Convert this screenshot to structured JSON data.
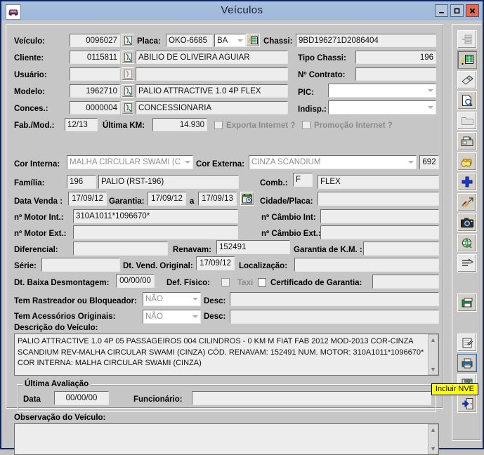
{
  "window": {
    "title": "Veículos",
    "icon": "car-icon",
    "buttons": {
      "minimize": "–",
      "maximize": "□",
      "close": "X"
    }
  },
  "form": {
    "veiculo": {
      "label": "Veículo:",
      "code": "0096027"
    },
    "placa": {
      "label": "Placa:",
      "value": "OKO-6685",
      "uf": "BA"
    },
    "chassi": {
      "label": "Chassi:",
      "value": "9BD196271D2086404"
    },
    "cliente": {
      "label": "Cliente:",
      "code": "0115811",
      "name": "ABILIO DE OLIVEIRA AGUIAR"
    },
    "tipo_chassi": {
      "label": "Tipo Chassi:",
      "value": "196"
    },
    "usuario": {
      "label": "Usuário:",
      "code": "",
      "name": ""
    },
    "n_contrato": {
      "label": "Nº Contrato:",
      "value": ""
    },
    "modelo": {
      "label": "Modelo:",
      "code": "1962710",
      "name": "PALIO ATTRACTIVE 1.0 4P FLEX"
    },
    "pic": {
      "label": "PIC:",
      "value": ""
    },
    "conces": {
      "label": "Conces.:",
      "code": "0000004",
      "name": "CONCESSIONARIA"
    },
    "indisp": {
      "label": "Indisp.:",
      "value": ""
    },
    "fab_mod": {
      "label": "Fab./Mod.:",
      "value": "12/13"
    },
    "ultima_km": {
      "label": "Última KM:",
      "value": "14.930"
    },
    "exporta_internet": {
      "label": "Exporta Internet ?",
      "checked": false
    },
    "promocao_internet": {
      "label": "Promoção Internet ?",
      "checked": false
    },
    "cor_interna": {
      "label": "Cor Interna:",
      "value": "MALHA CIRCULAR SWAMI (C"
    },
    "cor_externa": {
      "label": "Cor Externa:",
      "value": "CINZA SCANDIUM",
      "code": "692"
    },
    "familia": {
      "label": "Família:",
      "code": "196",
      "name": "PALIO (RST-196)"
    },
    "comb": {
      "label": "Comb.:",
      "code": "F",
      "name": "FLEX"
    },
    "data_venda": {
      "label": "Data Venda :",
      "value": "17/09/12"
    },
    "garantia": {
      "label": "Garantia:",
      "from": "17/09/12",
      "sep": "a",
      "to": "17/09/13"
    },
    "cidade_placa": {
      "label": "Cidade/Placa:",
      "value": ""
    },
    "n_motor_int": {
      "label": "nº Motor Int.:",
      "value": "310A1011*1096670*"
    },
    "n_cambio_int": {
      "label": "nº Câmbio Int:",
      "value": ""
    },
    "n_motor_ext": {
      "label": "nº Motor Ext.:",
      "value": ""
    },
    "n_cambio_ext": {
      "label": "nº Câmbio Ext.:",
      "value": ""
    },
    "diferencial": {
      "label": "Diferencial:",
      "value": ""
    },
    "renavam": {
      "label": "Renavam:",
      "value": "152491"
    },
    "garantia_km": {
      "label": "Garantia de K.M. :",
      "value": ""
    },
    "serie": {
      "label": "Série:",
      "value": ""
    },
    "dt_vend_original": {
      "label": "Dt. Vend. Original:",
      "value": "17/09/12"
    },
    "localizacao": {
      "label": "Localização:",
      "value": ""
    },
    "dt_baixa": {
      "label": "Dt. Baixa Desmontagem:",
      "value": "00/00/00"
    },
    "def_fisico": {
      "label": "Def. Físico:",
      "checked": false
    },
    "taxi": {
      "label": "Taxi",
      "checked": false
    },
    "certificado_garantia": {
      "label": "Certificado de Garantia:",
      "value": ""
    },
    "rastreador": {
      "label": "Tem Rastreador ou Bloqueador:",
      "value": "NÃO",
      "desc_label": "Desc:",
      "desc": ""
    },
    "acessorios": {
      "label": "Tem Acessórios Originais:",
      "value": "NÃO",
      "desc_label": "Desc:",
      "desc": ""
    },
    "descricao_veiculo": {
      "label": "Descrição do Veículo:",
      "text": "PALIO ATTRACTIVE 1.0 4P 05 PASSAGEIROS 004 CILINDROS - 0 KM M FIAT FAB 2012 MOD-2013 COR-CINZA SCANDIUM REV-MALHA CIRCULAR SWAMI (CINZA) CÓD. RENAVAM: 152491 NUM. MOTOR: 310A1011*1096670* COR INTERNA: MALHA CIRCULAR SWAMI (CINZA)"
    },
    "ultima_avaliacao": {
      "title": "Última Avaliação",
      "data_label": "Data",
      "data_value": "00/00/00",
      "funcionario_label": "Funcionário:",
      "funcionario_value": ""
    },
    "observacao": {
      "label": "Observação do Veículo:",
      "text": ""
    }
  },
  "toolbar": {
    "items": [
      {
        "name": "tree-view-icon",
        "enabled": false
      },
      {
        "name": "edit-grid-icon",
        "enabled": true
      },
      {
        "name": "eraser-icon",
        "enabled": true
      },
      {
        "name": "search-page-icon",
        "enabled": true
      },
      {
        "name": "open-folder-icon",
        "enabled": false
      },
      {
        "name": "print-camera-icon",
        "enabled": true
      },
      {
        "name": "copy-pages-icon",
        "enabled": true
      },
      {
        "name": "add-plus-icon",
        "enabled": true
      },
      {
        "name": "tools-icon",
        "enabled": true
      },
      {
        "name": "camera-icon",
        "enabled": true
      },
      {
        "name": "globe-icon",
        "enabled": true
      },
      {
        "name": "list-filter-icon",
        "enabled": true
      },
      {
        "name": "print-book-icon",
        "enabled": true
      },
      {
        "name": "note-edit-icon",
        "enabled": true
      },
      {
        "name": "incluir-nve-icon",
        "enabled": true
      },
      {
        "name": "save-check-icon",
        "enabled": true
      },
      {
        "name": "exit-door-icon",
        "enabled": true
      }
    ]
  },
  "tooltip": {
    "text": "Incluir NVE"
  },
  "colors": {
    "titlebar": "#a3bcdb",
    "face": "#c6c6c6",
    "field": "#ededed",
    "tooltip_bg": "#ffff00",
    "close_btn": "#e06a54"
  }
}
